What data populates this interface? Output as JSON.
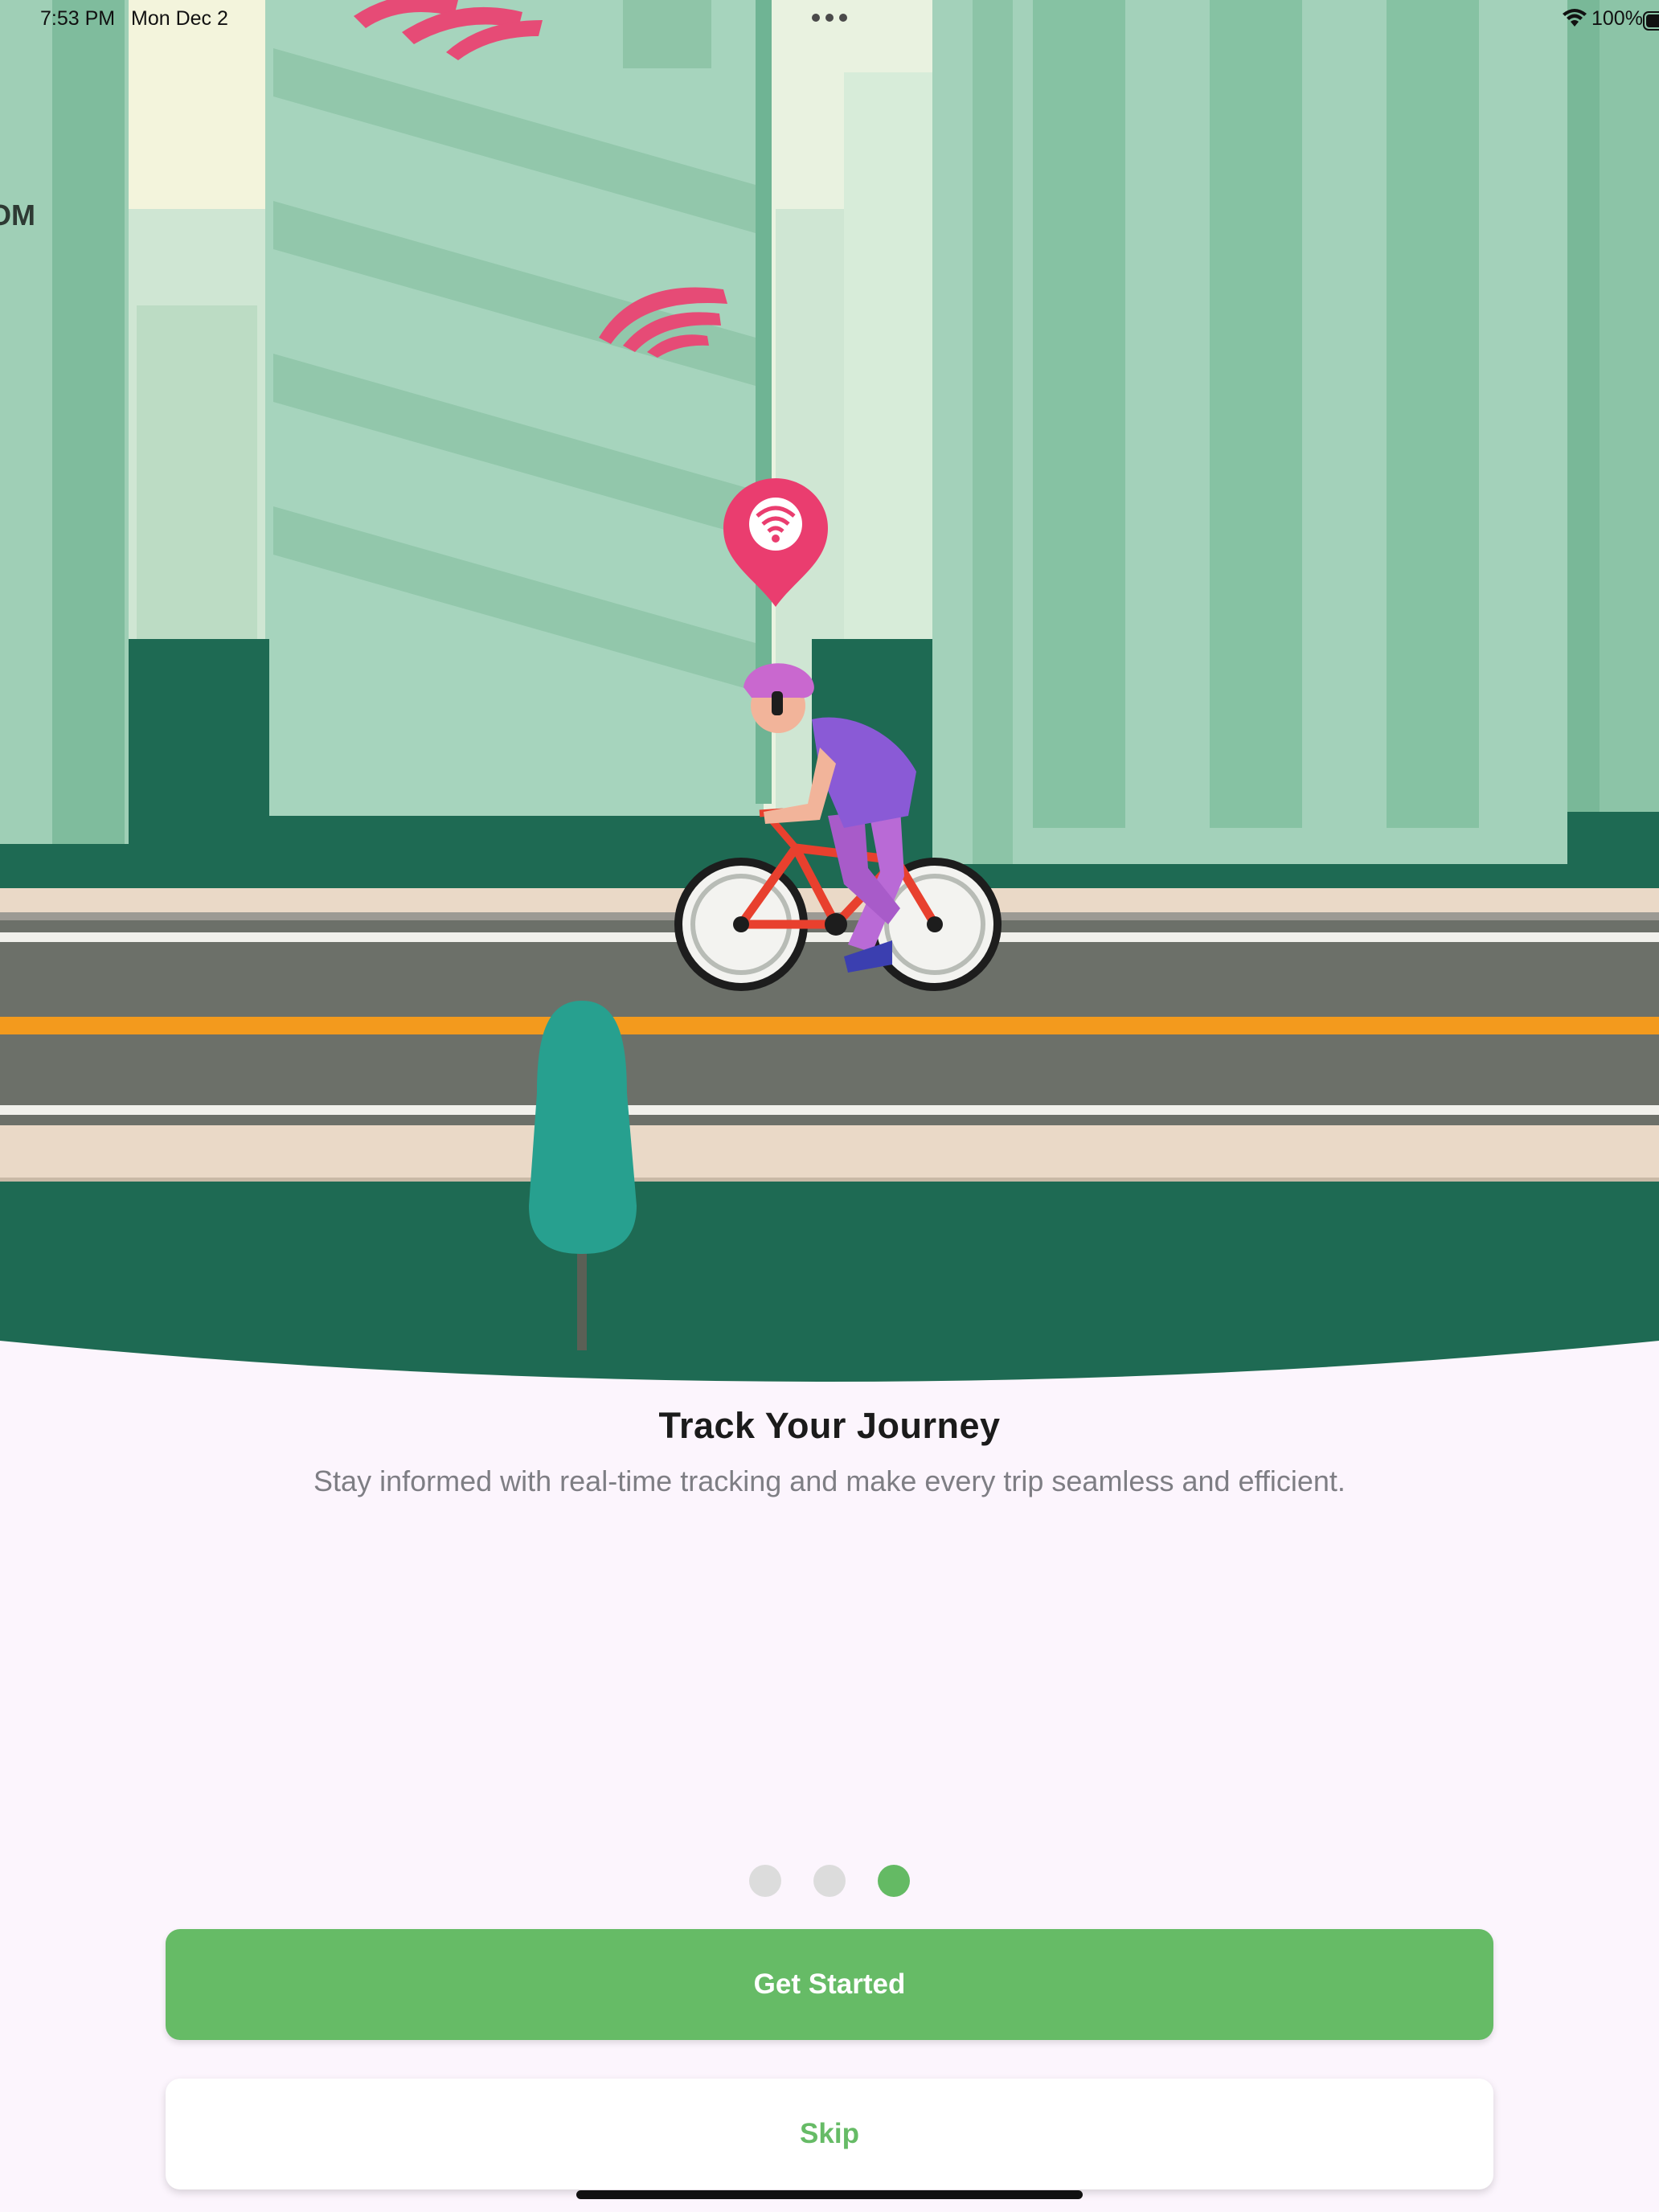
{
  "status_bar": {
    "time": "7:53 PM",
    "date": "Mon Dec 2",
    "battery_percent": "100%",
    "icons": [
      "wifi-icon",
      "battery-icon",
      "more-dots-icon"
    ]
  },
  "illustration": {
    "wall_text": "OM",
    "icons": [
      "signal-waves-icon",
      "location-pin-wifi-icon",
      "cyclist-illustration",
      "tree-illustration"
    ]
  },
  "onboarding": {
    "title": "Track Your Journey",
    "subtitle": "Stay informed with real-time tracking and make every trip seamless and efficient.",
    "page_count": 3,
    "active_page": 3
  },
  "buttons": {
    "primary_label": "Get Started",
    "secondary_label": "Skip"
  },
  "colors": {
    "accent": "#66bb66",
    "background": "#fcf5fd",
    "building_green": "#9fcfb6",
    "dark_green": "#1e6a53",
    "pin_pink": "#ea3d6f"
  }
}
